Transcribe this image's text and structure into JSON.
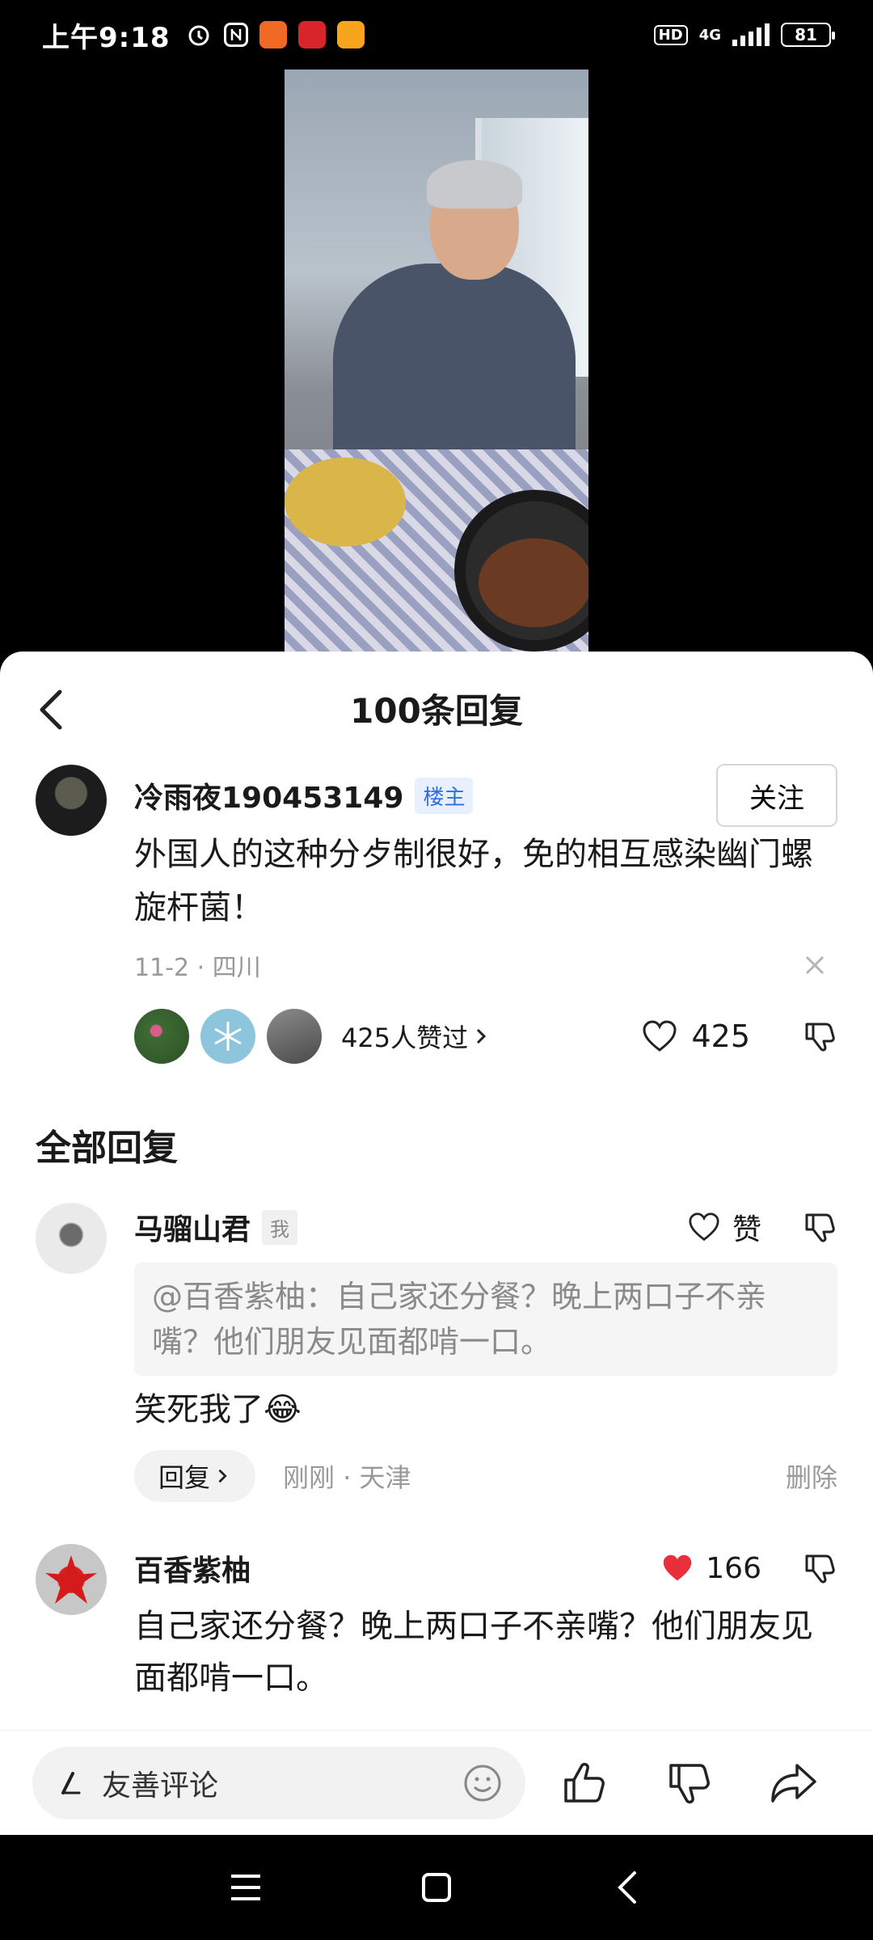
{
  "status_bar": {
    "time": "上午9:18",
    "hd": "HD",
    "network": "4G",
    "battery": "81"
  },
  "panel": {
    "title": "100条回复"
  },
  "main_comment": {
    "author": "冷雨夜190453149",
    "owner_tag": "楼主",
    "follow_label": "关注",
    "text": "外国人的这种分歺制很好，免的相互感染幽门螺旋杆菌！",
    "meta": "11-2 · 四川",
    "liked_summary": "425人赞过",
    "like_count": "425"
  },
  "section": {
    "all_replies": "全部回复"
  },
  "replies": [
    {
      "author": "马骝山君",
      "me_tag": "我",
      "like_label": "赞",
      "quote": "@百香紫柚：自己家还分餐？晚上两口子不亲嘴？他们朋友见面都啃一口。",
      "text": "笑死我了😂",
      "reply_label": "回复",
      "time": "刚刚 · 天津",
      "delete_label": "删除"
    },
    {
      "author": "百香紫柚",
      "like_count": "166",
      "text": "自己家还分餐？晚上两口子不亲嘴？他们朋友见面都啃一口。"
    }
  ],
  "bottom_bar": {
    "comment_placeholder": "友善评论"
  },
  "colors": {
    "accent_blue": "#2d6fe0",
    "liked_red": "#e8303c"
  }
}
